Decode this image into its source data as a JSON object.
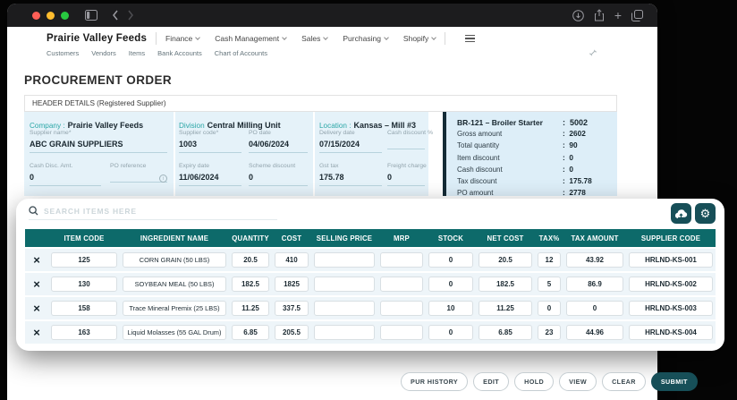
{
  "icons": {
    "back": "‹",
    "forward": "›",
    "plus": "+",
    "gear": "⚙",
    "delete": "×"
  },
  "colors": {
    "titlebar": "#1c1c1e",
    "traffic_red": "#ff5f57",
    "traffic_yellow": "#febc2e",
    "traffic_green": "#28c840",
    "table_header_teal": "#0d6a6a",
    "button_teal": "#174f58",
    "label_teal": "#2ba7a7",
    "fields_blue": "#e5f2f9",
    "summary_blue": "#ddeef8",
    "summary_bar": "#142b36"
  },
  "nav": {
    "brand": "Prairie Valley Feeds",
    "menus": [
      {
        "label": "Finance"
      },
      {
        "label": "Cash Management"
      },
      {
        "label": "Sales"
      },
      {
        "label": "Purchasing"
      },
      {
        "label": "Shopify"
      }
    ],
    "sub_nav": [
      "Customers",
      "Vendors",
      "Items",
      "Bank Accounts",
      "Chart of Accounts"
    ]
  },
  "page": {
    "title": "PROCUREMENT ORDER"
  },
  "header_details": {
    "title": "HEADER DETAILS (Registered Supplier)",
    "company": {
      "label": "Company :",
      "value": "Prairie Valley Feeds"
    },
    "division": {
      "label": "Division",
      "value": "Central Milling Unit"
    },
    "location": {
      "label": "Location :",
      "value": "Kansas – Mill #3"
    },
    "fields": [
      {
        "label": "Supplier name*",
        "value": "ABC GRAIN SUPPLIERS"
      },
      {
        "label": "Supplier code*",
        "value": "1003"
      },
      {
        "label": "PO date",
        "value": "04/06/2024"
      },
      {
        "label": "Delivery date",
        "value": "07/15/2024"
      },
      {
        "label": "Cash discount %",
        "value": ""
      },
      {
        "label": "Cash Disc. Amt.",
        "value": "0"
      },
      {
        "label": "PO reference",
        "value": ""
      },
      {
        "label": "Expiry date",
        "value": "11/06/2024"
      },
      {
        "label": "Scheme discount",
        "value": "0"
      },
      {
        "label": "Gst tax",
        "value": "175.78"
      },
      {
        "label": "Freight charge",
        "value": "0"
      }
    ]
  },
  "summary": {
    "title": {
      "label": "BR-121 – Broiler Starter",
      "value": "5002"
    },
    "rows": [
      {
        "label": "Gross amount",
        "value": "2602"
      },
      {
        "label": "Total quantity",
        "value": "90"
      },
      {
        "label": "Item discount",
        "value": "0"
      },
      {
        "label": "Cash discount",
        "value": "0"
      },
      {
        "label": "Tax discount",
        "value": "175.78"
      },
      {
        "label": "PO amount",
        "value": "2778"
      }
    ]
  },
  "items_panel": {
    "search_placeholder": "SEARCH ITEMS HERE",
    "columns": [
      "ITEM CODE",
      "INGREDIENT NAME",
      "QUANTITY",
      "COST",
      "SELLING PRICE",
      "MRP",
      "STOCK",
      "NET COST",
      "TAX%",
      "TAX AMOUNT",
      "SUPPLIER CODE"
    ],
    "rows": [
      {
        "item_code": "125",
        "ingredient_name": "CORN GRAIN (50 LBS)",
        "quantity": "20.5",
        "cost": "410",
        "selling_price": "",
        "mrp": "",
        "stock": "0",
        "net_cost": "20.5",
        "tax_pct": "12",
        "tax_amount": "43.92",
        "supplier_code": "HRLND-KS-001"
      },
      {
        "item_code": "130",
        "ingredient_name": "SOYBEAN MEAL (50 LBS)",
        "quantity": "182.5",
        "cost": "1825",
        "selling_price": "",
        "mrp": "",
        "stock": "0",
        "net_cost": "182.5",
        "tax_pct": "5",
        "tax_amount": "86.9",
        "supplier_code": "HRLND-KS-002"
      },
      {
        "item_code": "158",
        "ingredient_name": "Trace Mineral Premix (25 LBS)",
        "quantity": "11.25",
        "cost": "337.5",
        "selling_price": "",
        "mrp": "",
        "stock": "10",
        "net_cost": "11.25",
        "tax_pct": "0",
        "tax_amount": "0",
        "supplier_code": "HRLND-KS-003"
      },
      {
        "item_code": "163",
        "ingredient_name": "Liquid Molasses (55 GAL Drum)",
        "quantity": "6.85",
        "cost": "205.5",
        "selling_price": "",
        "mrp": "",
        "stock": "0",
        "net_cost": "6.85",
        "tax_pct": "23",
        "tax_amount": "44.96",
        "supplier_code": "HRLND-KS-004"
      }
    ]
  },
  "actions": {
    "buttons": [
      "PUR HISTORY",
      "EDIT",
      "HOLD",
      "VIEW",
      "CLEAR"
    ],
    "submit": "SUBMIT"
  }
}
